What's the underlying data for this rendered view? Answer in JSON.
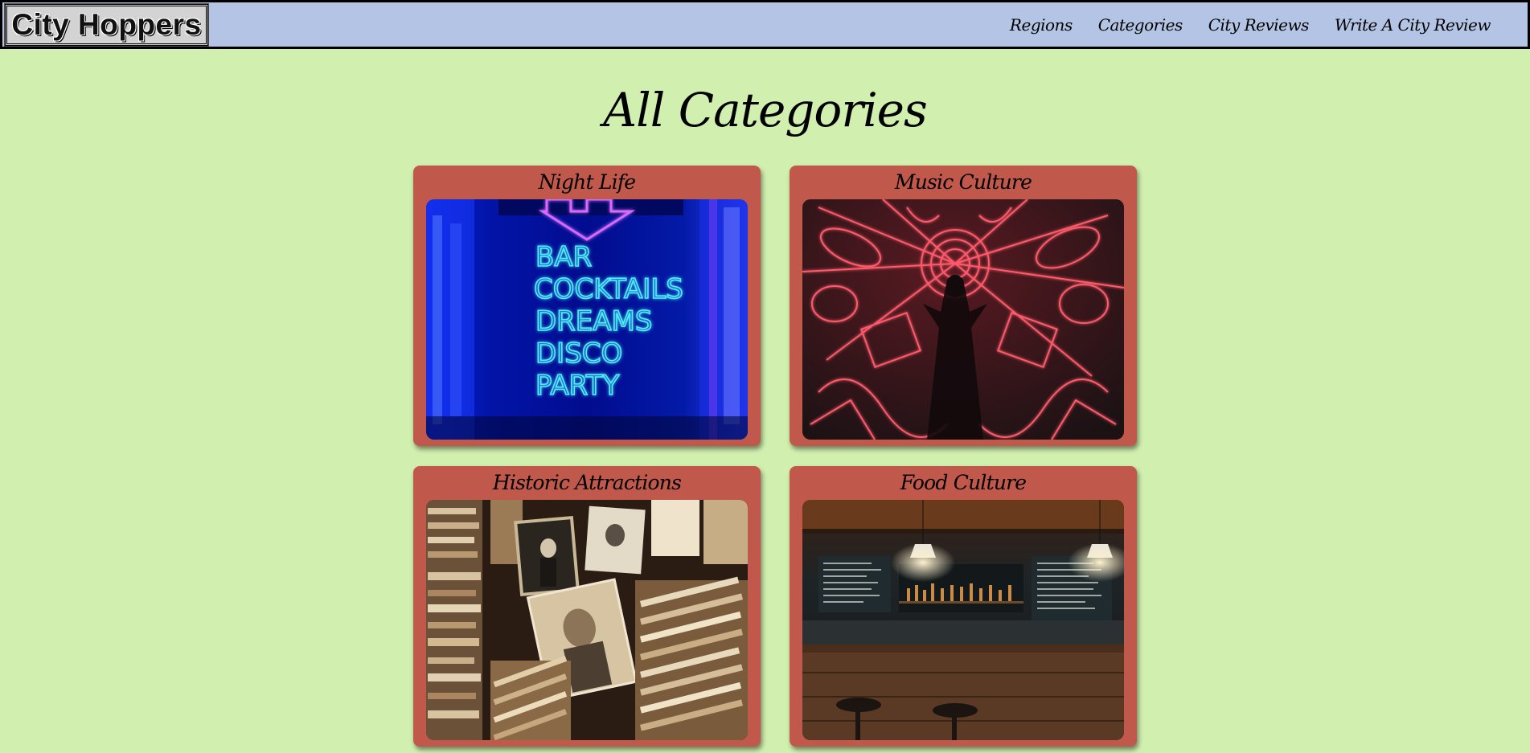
{
  "navbar": {
    "brand": "City Hoppers",
    "links": [
      {
        "label": "Regions"
      },
      {
        "label": "Categories"
      },
      {
        "label": "City Reviews"
      },
      {
        "label": "Write A City Review"
      }
    ]
  },
  "page": {
    "title": "All Categories"
  },
  "categories": [
    {
      "title": "Night Life",
      "image": "neon-bar-sign-image",
      "sign_lines": [
        "BAR",
        "COCKTAILS",
        "DREAMS",
        "DISCO",
        "PARTY"
      ]
    },
    {
      "title": "Music Culture",
      "image": "neon-music-instruments-image"
    },
    {
      "title": "Historic Attractions",
      "image": "vintage-photographs-image"
    },
    {
      "title": "Food Culture",
      "image": "restaurant-bar-interior-image"
    }
  ],
  "colors": {
    "background": "#d1efae",
    "navbar": "#b3c4e5",
    "brand_box": "#d3d3d3",
    "card": "#c0594b"
  }
}
